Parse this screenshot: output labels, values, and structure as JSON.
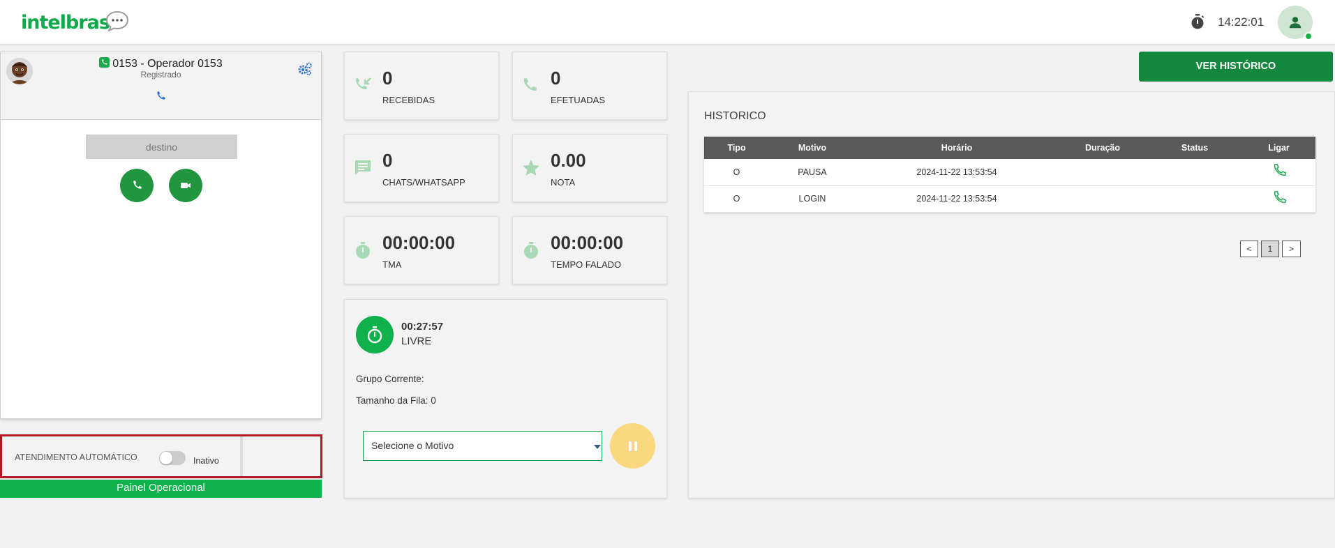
{
  "header": {
    "logo_text": "intelbras",
    "clock": "14:22:01",
    "accent_color": "#0fa84a"
  },
  "phone": {
    "operator_title": "0153 - Operador 0153",
    "registration_status": "Registrado",
    "destination_placeholder": "destino",
    "call_button_icon": "phone-icon",
    "video_button_icon": "video-camera-icon"
  },
  "auto_answer": {
    "label": "ATENDIMENTO AUTOMÁTICO",
    "toggle_state": "Inativo",
    "enabled": false
  },
  "panel_button": "Painel Operacional",
  "stats": {
    "recebidas": {
      "value": "0",
      "label": "RECEBIDAS",
      "icon": "incoming-call-icon"
    },
    "efetuadas": {
      "value": "0",
      "label": "EFETUADAS",
      "icon": "outgoing-call-icon"
    },
    "chats": {
      "value": "0",
      "label": "CHATS/WHATSAPP",
      "icon": "chat-icon"
    },
    "nota": {
      "value": "0.00",
      "label": "NOTA",
      "icon": "star-icon"
    },
    "tma": {
      "value": "00:00:00",
      "label": "TMA",
      "icon": "stopwatch-icon"
    },
    "tempo_falado": {
      "value": "00:00:00",
      "label": "TEMPO FALADO",
      "icon": "stopwatch-icon"
    }
  },
  "status": {
    "elapsed": "00:27:57",
    "state": "LIVRE",
    "grupo_label": "Grupo Corrente:",
    "fila_label": "Tamanho da Fila: 0",
    "motivo_placeholder": "Selecione o Motivo",
    "pause_color": "#fbd77f"
  },
  "history": {
    "button": "VER HISTÓRICO",
    "title": "HISTORICO",
    "columns": [
      "Tipo",
      "Motivo",
      "Horário",
      "Duração",
      "Status",
      "Ligar"
    ],
    "rows": [
      {
        "tipo": "O",
        "motivo": "PAUSA",
        "horario": "2024-11-22 13:53:54",
        "duracao": "",
        "status": ""
      },
      {
        "tipo": "O",
        "motivo": "LOGIN",
        "horario": "2024-11-22 13:53:54",
        "duracao": "",
        "status": ""
      }
    ],
    "pager": {
      "prev": "<",
      "page": "1",
      "next": ">"
    }
  }
}
